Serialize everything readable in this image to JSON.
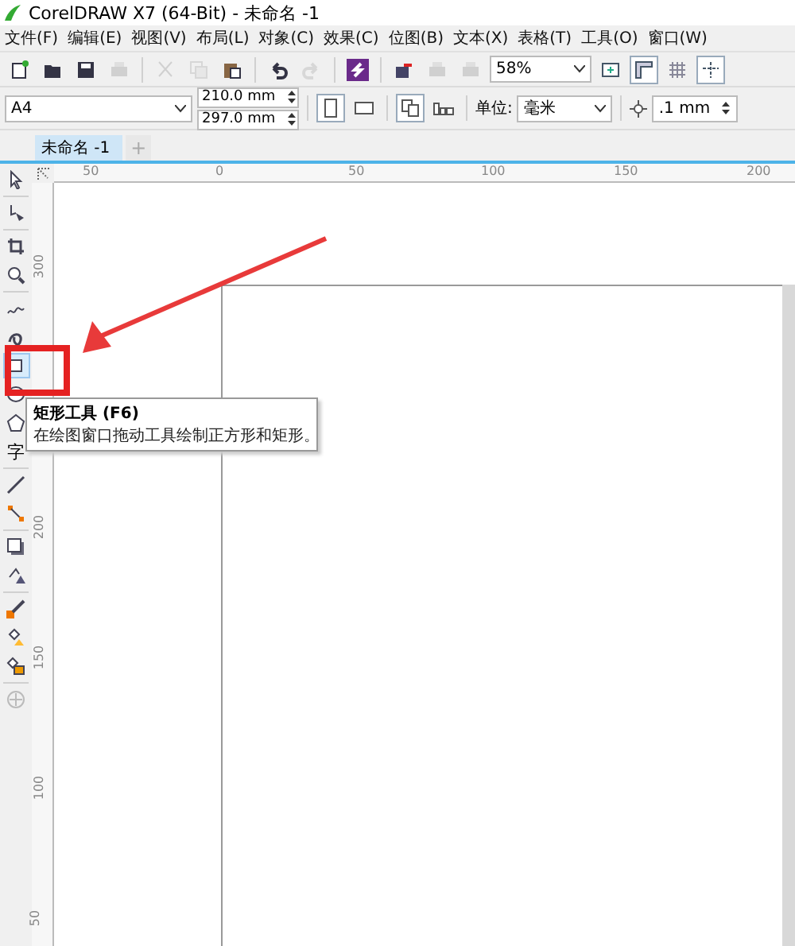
{
  "window": {
    "title": "CorelDRAW X7 (64-Bit) - 未命名 -1"
  },
  "menu": [
    "文件(F)",
    "编辑(E)",
    "视图(V)",
    "布局(L)",
    "对象(C)",
    "效果(C)",
    "位图(B)",
    "文本(X)",
    "表格(T)",
    "工具(O)",
    "窗口(W)"
  ],
  "toolbar": [
    {
      "kind": "new",
      "disabled": false
    },
    {
      "kind": "open",
      "disabled": false
    },
    {
      "kind": "save",
      "disabled": false
    },
    {
      "kind": "print",
      "disabled": true
    },
    {
      "kind": "sep"
    },
    {
      "kind": "cut",
      "disabled": true
    },
    {
      "kind": "copy",
      "disabled": true
    },
    {
      "kind": "paste",
      "disabled": false
    },
    {
      "kind": "sep"
    },
    {
      "kind": "undo",
      "disabled": false
    },
    {
      "kind": "redo",
      "disabled": true
    },
    {
      "kind": "sep"
    },
    {
      "kind": "launch",
      "disabled": false
    },
    {
      "kind": "sep"
    },
    {
      "kind": "import",
      "disabled": false
    },
    {
      "kind": "export",
      "disabled": true
    },
    {
      "kind": "publish",
      "disabled": true
    }
  ],
  "zoom": {
    "value": "58%"
  },
  "toolbar_end": [
    {
      "kind": "fullscreen",
      "selected": false
    },
    {
      "kind": "rulers",
      "selected": true
    },
    {
      "kind": "grid",
      "selected": false
    },
    {
      "kind": "guides",
      "selected": true
    }
  ],
  "property_bar": {
    "page_size": "A4",
    "width": "210.0 mm",
    "height": "297.0 mm",
    "portrait_selected": true,
    "units_label": "单位:",
    "units": "毫米",
    "nudge": ".1 mm"
  },
  "document_tabs": [
    {
      "label": "未命名 -1",
      "selected": true
    }
  ],
  "new_tab": "+",
  "ruler": {
    "horizontal": [
      "50",
      "0",
      "50",
      "100",
      "150",
      "200"
    ],
    "vertical": [
      "300",
      "200",
      "150",
      "100",
      "50"
    ]
  },
  "tools": [
    {
      "kind": "pick",
      "selected": false
    },
    {
      "kind": "sep"
    },
    {
      "kind": "shape",
      "selected": false
    },
    {
      "kind": "sep"
    },
    {
      "kind": "crop",
      "selected": false
    },
    {
      "kind": "zoom",
      "selected": false
    },
    {
      "kind": "sep"
    },
    {
      "kind": "freehand",
      "selected": false
    },
    {
      "kind": "artistic",
      "selected": false
    },
    {
      "kind": "rectangle",
      "selected": true
    },
    {
      "kind": "ellipse",
      "selected": false
    },
    {
      "kind": "polygon",
      "selected": false
    },
    {
      "kind": "text",
      "label": "字",
      "selected": false
    },
    {
      "kind": "sep"
    },
    {
      "kind": "dimension",
      "selected": false
    },
    {
      "kind": "connector",
      "selected": false
    },
    {
      "kind": "sep"
    },
    {
      "kind": "shadow",
      "selected": false
    },
    {
      "kind": "transparency",
      "selected": false
    },
    {
      "kind": "sep"
    },
    {
      "kind": "eyedropper",
      "selected": false
    },
    {
      "kind": "fill",
      "selected": false
    },
    {
      "kind": "smartfill",
      "selected": false
    },
    {
      "kind": "sep"
    },
    {
      "kind": "add",
      "selected": false
    }
  ],
  "tooltip": {
    "title": "矩形工具 (F6)",
    "description": "在绘图窗口拖动工具绘制正方形和矩形。"
  }
}
